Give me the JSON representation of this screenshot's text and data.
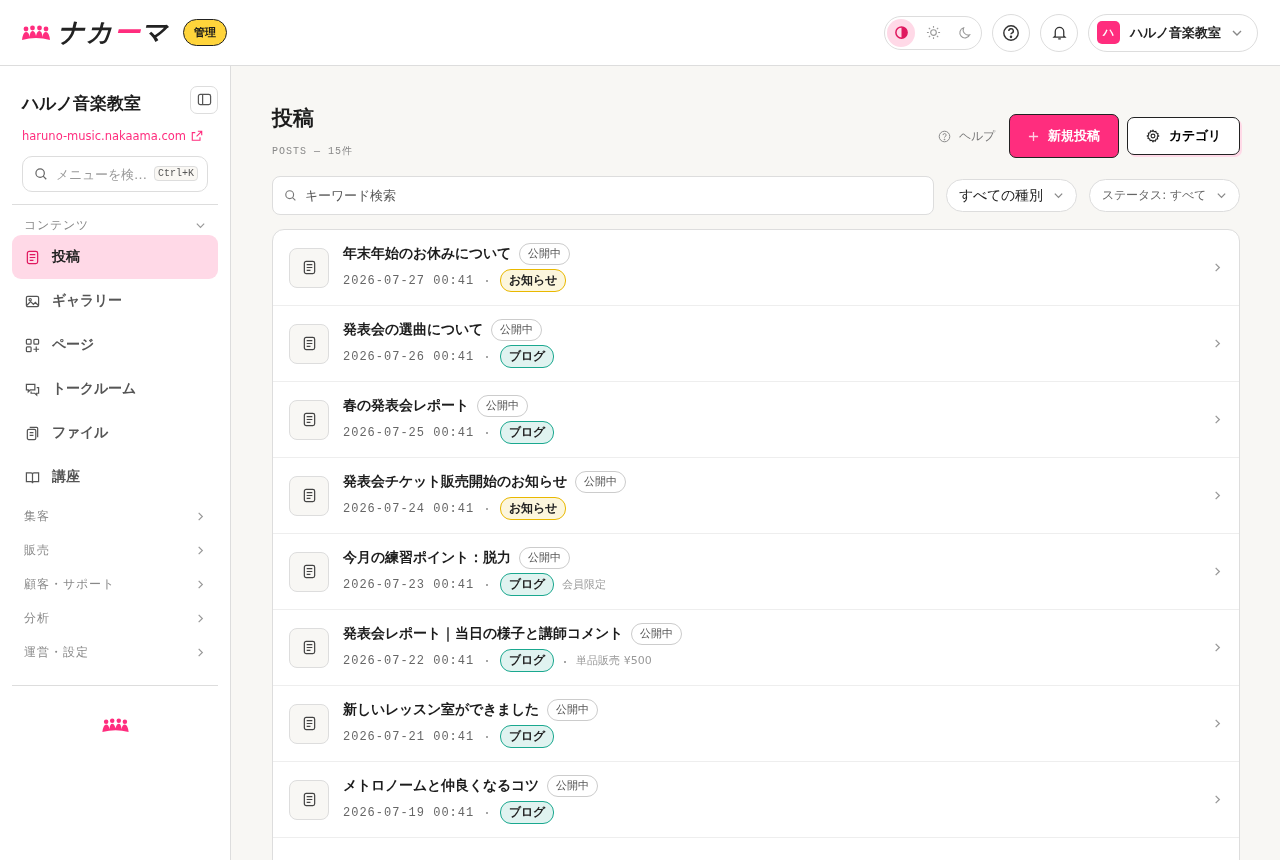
{
  "header": {
    "logo": [
      {
        "text": "ナカ",
        "accent": false
      },
      {
        "text": "ー",
        "accent": true
      },
      {
        "text": "マ",
        "accent": false
      }
    ],
    "badge": "管理",
    "theme_modes": [
      {
        "kind": "auto",
        "selected": true
      },
      {
        "kind": "light",
        "selected": false
      },
      {
        "kind": "dark",
        "selected": false
      }
    ],
    "account": {
      "initial": "ハ",
      "name": "ハルノ音楽教室"
    }
  },
  "sidebar": {
    "title": "ハルノ音楽教室",
    "site_link": "haruno-music.nakaama.com",
    "search": {
      "placeholder": "メニューを検…",
      "shortcut": "Ctrl+K"
    },
    "sections": [
      {
        "label": "コンテンツ",
        "expanded": true,
        "items": [
          {
            "label": "投稿",
            "kind": "post",
            "selected": true
          },
          {
            "label": "ギャラリー",
            "kind": "gallery",
            "selected": false
          },
          {
            "label": "ページ",
            "kind": "page",
            "selected": false
          },
          {
            "label": "トークルーム",
            "kind": "talk",
            "selected": false
          },
          {
            "label": "ファイル",
            "kind": "file",
            "selected": false
          },
          {
            "label": "講座",
            "kind": "course",
            "selected": false
          }
        ]
      },
      {
        "label": "集客",
        "expanded": false
      },
      {
        "label": "販売",
        "expanded": false
      },
      {
        "label": "顧客・サポート",
        "expanded": false
      },
      {
        "label": "分析",
        "expanded": false
      },
      {
        "label": "運営・設定",
        "expanded": false
      }
    ]
  },
  "page": {
    "title": "投稿",
    "subtitle": "POSTS — 15件",
    "help": "ヘルプ",
    "new_button": "新規投稿",
    "category_button": "カテゴリ",
    "search": {
      "placeholder": "キーワード検索"
    },
    "filters": [
      {
        "label": "すべての種別",
        "muted": false
      },
      {
        "label": "ステータス: すべて",
        "muted": true
      }
    ],
    "posts": [
      {
        "title": "年末年始のお休みについて",
        "status": "公開中",
        "date": "2026-07-27 00:41",
        "tag": {
          "label": "お知らせ",
          "color": "#e9b800"
        }
      },
      {
        "title": "発表会の選曲について",
        "status": "公開中",
        "date": "2026-07-26 00:41",
        "tag": {
          "label": "ブログ",
          "color": "#1aa88f"
        }
      },
      {
        "title": "春の発表会レポート",
        "status": "公開中",
        "date": "2026-07-25 00:41",
        "tag": {
          "label": "ブログ",
          "color": "#1aa88f"
        }
      },
      {
        "title": "発表会チケット販売開始のお知らせ",
        "status": "公開中",
        "date": "2026-07-24 00:41",
        "tag": {
          "label": "お知らせ",
          "color": "#e9b800"
        }
      },
      {
        "title": "今月の練習ポイント：脱力",
        "status": "公開中",
        "date": "2026-07-23 00:41",
        "tag": {
          "label": "ブログ",
          "color": "#1aa88f"
        },
        "note": {
          "text": "会員限定",
          "separated": false
        }
      },
      {
        "title": "発表会レポート｜当日の様子と講師コメント",
        "status": "公開中",
        "date": "2026-07-22 00:41",
        "tag": {
          "label": "ブログ",
          "color": "#1aa88f"
        },
        "note": {
          "text": "単品販売 ¥500",
          "separated": true
        }
      },
      {
        "title": "新しいレッスン室ができました",
        "status": "公開中",
        "date": "2026-07-21 00:41",
        "tag": {
          "label": "ブログ",
          "color": "#1aa88f"
        }
      },
      {
        "title": "メトロノームと仲良くなるコツ",
        "status": "公開中",
        "date": "2026-07-19 00:41",
        "tag": {
          "label": "ブログ",
          "color": "#1aa88f"
        }
      }
    ]
  }
}
